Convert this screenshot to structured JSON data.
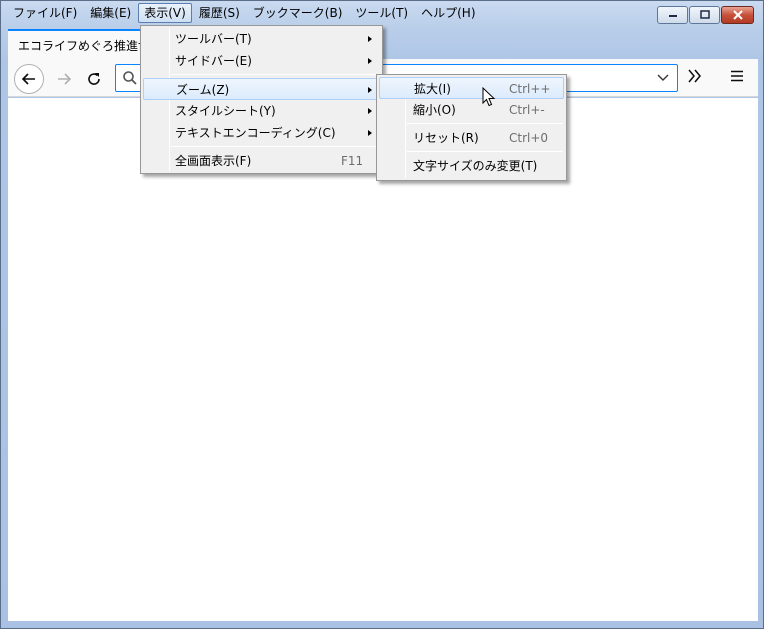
{
  "menubar": {
    "items": [
      {
        "label": "ファイル(F)"
      },
      {
        "label": "編集(E)"
      },
      {
        "label": "表示(V)"
      },
      {
        "label": "履歴(S)"
      },
      {
        "label": "ブックマーク(B)"
      },
      {
        "label": "ツール(T)"
      },
      {
        "label": "ヘルプ(H)"
      }
    ],
    "active_index": 2
  },
  "tab": {
    "title": "エコライフめぐろ推進協会"
  },
  "icons": {
    "back": "back-arrow-icon",
    "forward": "forward-arrow-icon",
    "reload": "reload-icon",
    "search": "search-icon",
    "dropdown": "chevron-down-icon",
    "overflow": "double-chevron-icon",
    "menu": "hamburger-icon"
  },
  "view_menu": {
    "items": [
      {
        "label": "ツールバー(T)",
        "submenu": true
      },
      {
        "label": "サイドバー(E)",
        "submenu": true
      },
      {
        "label": "ズーム(Z)",
        "submenu": true,
        "highlighted": true
      },
      {
        "label": "スタイルシート(Y)",
        "submenu": true
      },
      {
        "label": "テキストエンコーディング(C)",
        "submenu": true
      },
      {
        "label": "全画面表示(F)",
        "shortcut": "F11"
      }
    ]
  },
  "zoom_menu": {
    "items": [
      {
        "label": "拡大(I)",
        "shortcut": "Ctrl++",
        "highlighted": true
      },
      {
        "label": "縮小(O)",
        "shortcut": "Ctrl+-"
      },
      {
        "label": "リセット(R)",
        "shortcut": "Ctrl+0"
      },
      {
        "label": "文字サイズのみ変更(T)"
      }
    ]
  },
  "colors": {
    "accent": "#0a84ff",
    "menu_bg": "#f0f0f0",
    "highlight": "#dcebfc"
  }
}
